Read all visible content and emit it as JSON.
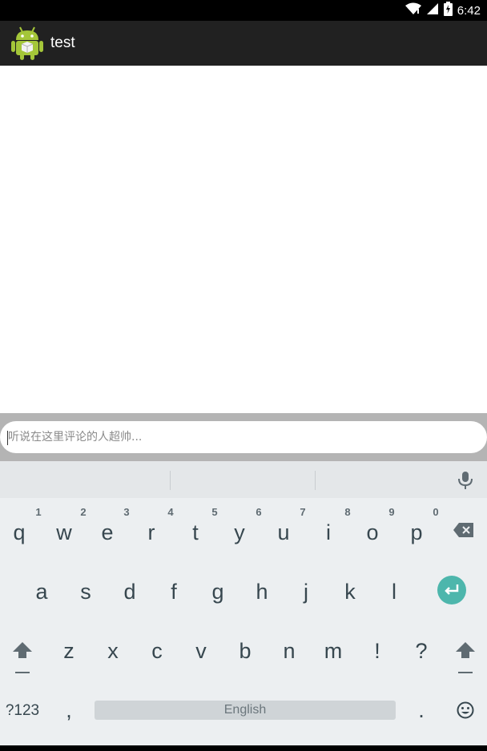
{
  "status_bar": {
    "time": "6:42",
    "icons": [
      "wifi-icon",
      "signal-icon",
      "battery-icon"
    ]
  },
  "action_bar": {
    "app_icon": "android-icon",
    "title": "test"
  },
  "comment": {
    "placeholder": "听说在这里评论的人超帅...",
    "value": ""
  },
  "keyboard": {
    "row1": [
      {
        "key": "q",
        "hint": "1"
      },
      {
        "key": "w",
        "hint": "2"
      },
      {
        "key": "e",
        "hint": "3"
      },
      {
        "key": "r",
        "hint": "4"
      },
      {
        "key": "t",
        "hint": "5"
      },
      {
        "key": "y",
        "hint": "6"
      },
      {
        "key": "u",
        "hint": "7"
      },
      {
        "key": "i",
        "hint": "8"
      },
      {
        "key": "o",
        "hint": "9"
      },
      {
        "key": "p",
        "hint": "0"
      }
    ],
    "row2": [
      "a",
      "s",
      "d",
      "f",
      "g",
      "h",
      "j",
      "k",
      "l"
    ],
    "row3": [
      "z",
      "x",
      "c",
      "v",
      "b",
      "n",
      "m",
      "!",
      "?"
    ],
    "symbols_label": "?123",
    "comma_label": ",",
    "space_label": "English",
    "period_label": ".",
    "icons": [
      "mic-icon",
      "backspace-icon",
      "enter-icon",
      "shift-icon",
      "emoji-icon"
    ],
    "accent_color": "#4db6ac"
  }
}
